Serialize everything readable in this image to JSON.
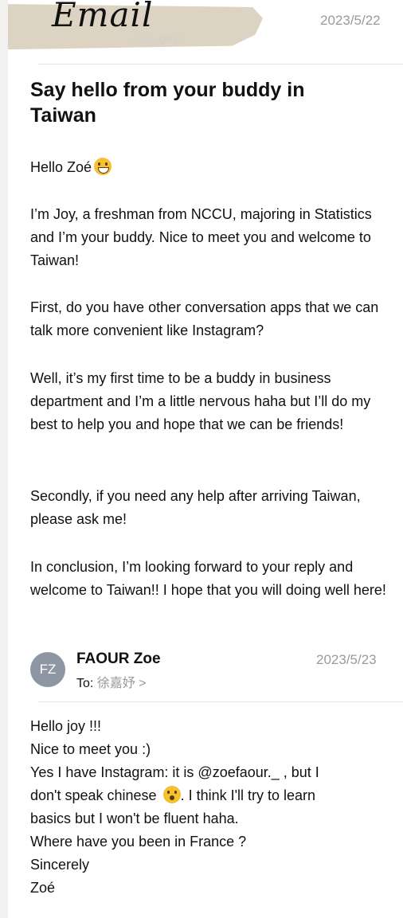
{
  "header": {
    "title": "Email"
  },
  "message1": {
    "date": "2023/5/22",
    "sender_faded": "...@...gm >",
    "subject": "Say hello from your buddy in Taiwan",
    "greeting": "Hello Zoé",
    "paragraphs": [
      "I’m Joy, a freshman from NCCU, majoring in Statistics and I’m your buddy. Nice to meet you and welcome to Taiwan!",
      "First, do you have other conversation apps that we can talk more convenient like Instagram?",
      "Well, it’s my first time to be a buddy in business department and I’m a little nervous haha but I’ll do my best to help you and hope that we can be friends!",
      "Secondly, if you need any help after arriving Taiwan, please ask me!",
      "In conclusion, I’m looking forward to your reply and welcome to Taiwan!! I hope that you will doing well here!"
    ]
  },
  "message2": {
    "avatar_initials": "FZ",
    "sender": "FAOUR Zoe",
    "to_label": "To:",
    "to_name": "徐嘉妤 >",
    "date": "2023/5/23",
    "lines": [
      "Hello joy !!!",
      "Nice to meet you :)",
      "Yes I have Instagram: it is @zoefaour._ , but I",
      "don't speak chinese",
      ". I think I'll try to learn",
      "basics but I won't be fluent haha.",
      "Where have you been in France ?",
      "Sincerely",
      "Zoé"
    ]
  },
  "icons": {
    "emoji1": "grinning-face-icon",
    "emoji2": "hushed-face-icon"
  }
}
